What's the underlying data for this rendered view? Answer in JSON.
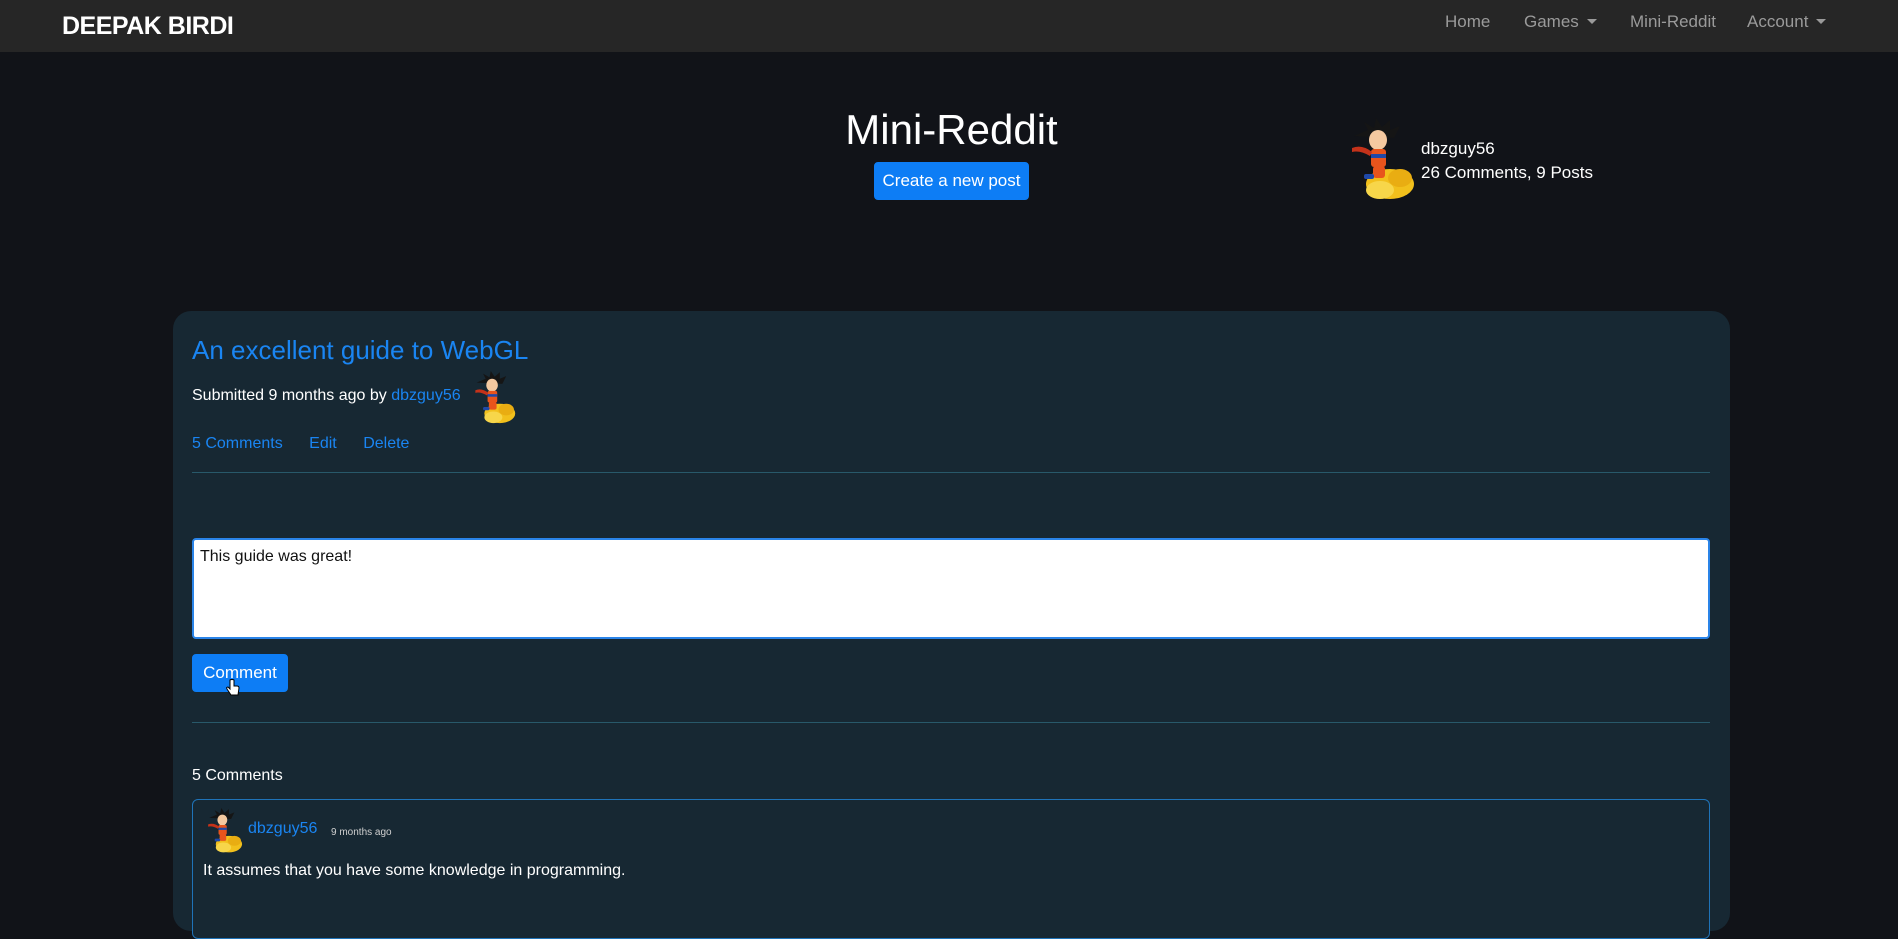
{
  "navbar": {
    "brand": "DEEPAK BIRDI",
    "links": {
      "home": "Home",
      "games": "Games",
      "mini_reddit": "Mini-Reddit",
      "account": "Account"
    }
  },
  "hero": {
    "title": "Mini-Reddit",
    "create_button": "Create a new post"
  },
  "user_card": {
    "username": "dbzguy56",
    "stats": "26 Comments, 9 Posts"
  },
  "post": {
    "title": "An excellent guide to WebGL",
    "submitted_prefix": "Submitted 9 months ago by",
    "author": "dbzguy56",
    "actions": {
      "comments": "5 Comments",
      "edit": "Edit",
      "delete": "Delete"
    },
    "comment_input_value": "This guide was great!",
    "comment_button": "Comment",
    "comments_heading": "5 Comments",
    "comments": [
      {
        "user": "dbzguy56",
        "time": "9 months ago",
        "text": "It assumes that you have some knowledge in programming."
      }
    ]
  },
  "colors": {
    "background": "#111318",
    "navbar": "#262626",
    "card": "#172833",
    "link": "#1a85f2",
    "primary_button": "#0d7df5"
  }
}
